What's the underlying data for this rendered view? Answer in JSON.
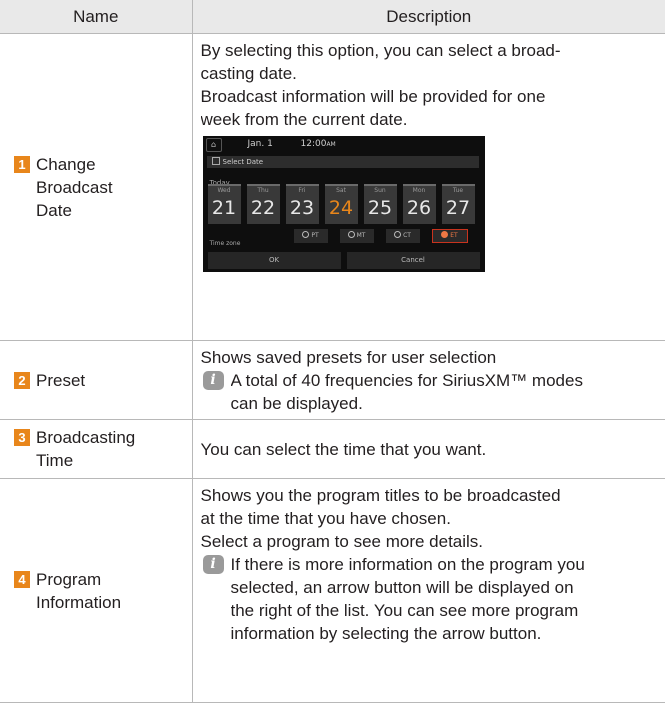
{
  "headers": {
    "name": "Name",
    "description": "Description"
  },
  "rows": [
    {
      "num": "1",
      "name_lines": [
        "Change",
        "Broadcast",
        "Date"
      ],
      "desc_lines": [
        "By selecting this option, you can select a broad-",
        "casting date.",
        "Broadcast information will be provided for one",
        "week from the current date."
      ],
      "screenshot": {
        "home_icon": "home-icon",
        "date": "Jan. 1",
        "time": "12:00",
        "time_suffix": "AM",
        "dialog_title": "Select Date",
        "today_label": "Today",
        "days": [
          {
            "name": "Wed",
            "num": "21"
          },
          {
            "name": "Thu",
            "num": "22"
          },
          {
            "name": "Fri",
            "num": "23"
          },
          {
            "name": "Sat",
            "num": "24"
          },
          {
            "name": "Sun",
            "num": "25"
          },
          {
            "name": "Mon",
            "num": "26"
          },
          {
            "name": "Tue",
            "num": "27"
          }
        ],
        "selected_day": "24",
        "timezone_label": "Time zone",
        "timezones": [
          "PT",
          "MT",
          "CT",
          "ET"
        ],
        "selected_timezone": "ET",
        "ok_label": "OK",
        "cancel_label": "Cancel",
        "accent_color": "#e8861b"
      }
    },
    {
      "num": "2",
      "name_lines": [
        "Preset"
      ],
      "desc_lines": [
        "Shows saved presets for user selection"
      ],
      "note_lines": [
        "A total of 40 frequencies for SiriusXM™ modes",
        "can be displayed."
      ]
    },
    {
      "num": "3",
      "name_lines": [
        "Broadcasting",
        "Time"
      ],
      "desc_lines": [
        "You can select the time that you want."
      ]
    },
    {
      "num": "4",
      "name_lines": [
        "Program",
        "Information"
      ],
      "desc_lines": [
        "Shows you the program titles to be broadcasted",
        "at the time that you have chosen.",
        "Select a program to see more details."
      ],
      "note_lines": [
        "If there is more information on the program you",
        "selected, an arrow button will be displayed on",
        "the right of the list. You can see more program",
        "information by selecting the arrow button."
      ]
    }
  ],
  "note_icon_glyph": "i",
  "colors": {
    "number_badge": "#e8861b",
    "header_bg": "#e9e9e9",
    "note_icon": "#9a9a9a"
  }
}
